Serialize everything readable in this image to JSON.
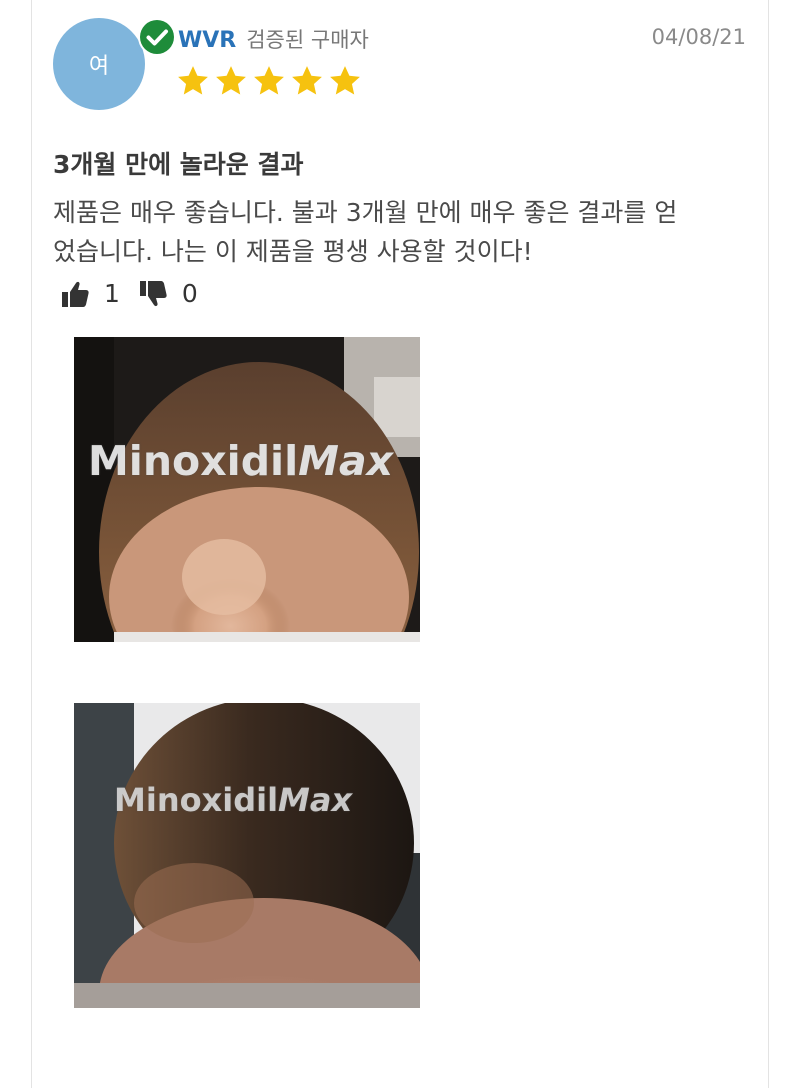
{
  "review": {
    "avatar_initial": "여",
    "reviewer_name": "WVR",
    "buyer_label": "검증된 구매자",
    "date": "04/08/21",
    "rating": 5,
    "title": "3개월 만에 놀라운 결과",
    "body_line1": "제품은 매우 좋습니다. 불과 3개월 만에 매우 좋은 결과를 얻",
    "body_line2": "었습니다. 나는 이 제품을 평생 사용할 것이다!",
    "helpful_count": "1",
    "unhelpful_count": "0"
  },
  "photos": [
    {
      "watermark_plain": "Minoxidil",
      "watermark_italic": "Max"
    },
    {
      "watermark_plain": "Minoxidil",
      "watermark_italic": "Max"
    }
  ],
  "icons": {
    "verified": "check-circle-icon",
    "star": "star-icon",
    "thumbs_up": "thumbs-up-icon",
    "thumbs_down": "thumbs-down-icon"
  },
  "colors": {
    "avatar_bg": "#7fb5dc",
    "verified_green": "#1e8c3a",
    "reviewer_name": "#2a73b8",
    "star": "#f6c20f",
    "text": "#4a4a4a"
  }
}
